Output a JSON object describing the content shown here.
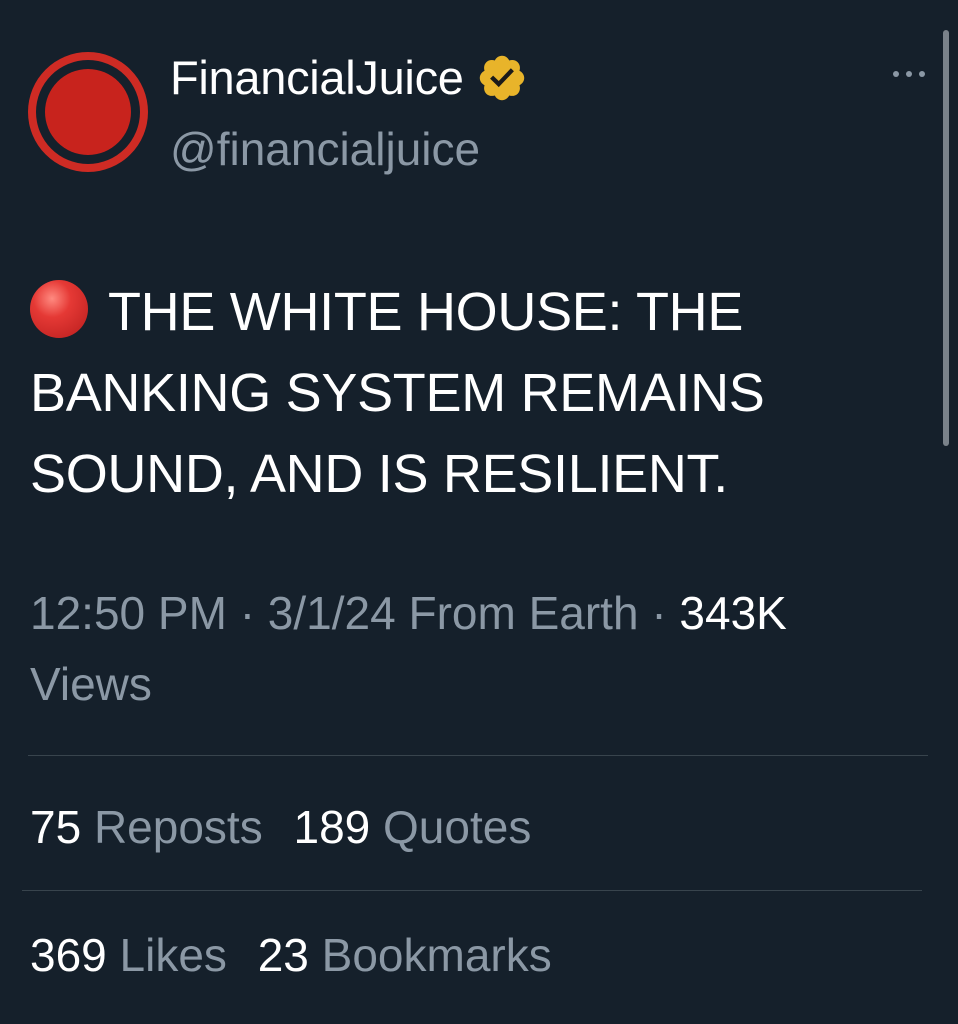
{
  "profile": {
    "display_name": "FinancialJuice",
    "handle": "@financialjuice"
  },
  "tweet": {
    "emoji": "red-circle-icon",
    "text": "THE WHITE HOUSE: THE BANKING SYSTEM REMAINS SOUND, AND IS RESILIENT."
  },
  "meta": {
    "time": "12:50 PM",
    "separator": "·",
    "date": "3/1/24",
    "source": "From Earth",
    "views_count": "343K",
    "views_label": "Views"
  },
  "stats": {
    "reposts_count": "75",
    "reposts_label": "Reposts",
    "quotes_count": "189",
    "quotes_label": "Quotes",
    "likes_count": "369",
    "likes_label": "Likes",
    "bookmarks_count": "23",
    "bookmarks_label": "Bookmarks"
  },
  "colors": {
    "background": "#15202b",
    "secondary_text": "#8b98a5",
    "divider": "#38444d",
    "verified_badge": "#e8b42a",
    "avatar_red": "#ce2b24"
  },
  "icons": [
    "verified-badge-icon",
    "more-options-icon",
    "red-circle-icon"
  ]
}
